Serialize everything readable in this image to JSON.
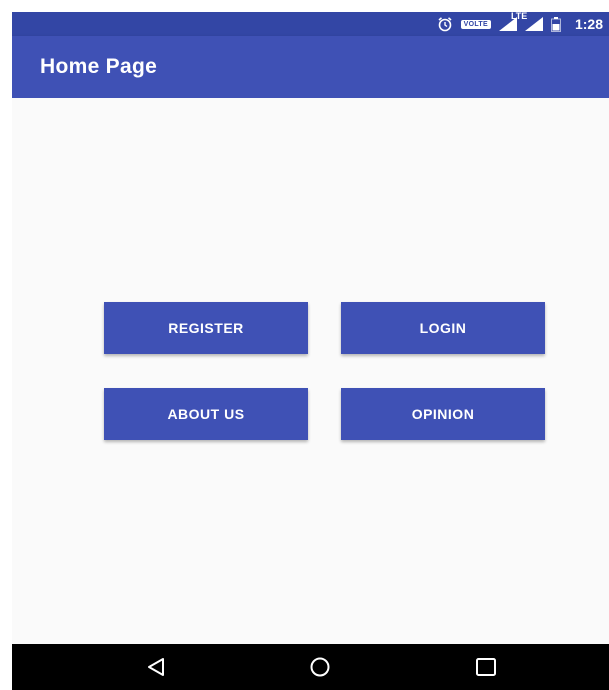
{
  "status_bar": {
    "volte_label": "VOLTE",
    "lte_label": "LTE",
    "time": "1:28",
    "icons": [
      "alarm-icon",
      "volte-icon",
      "signal-icon",
      "lte-signal-icon",
      "battery-icon"
    ]
  },
  "app_bar": {
    "title": "Home Page"
  },
  "buttons": {
    "register": "REGISTER",
    "login": "LOGIN",
    "about": "ABOUT US",
    "opinion": "OPINION"
  },
  "nav_bar": {
    "icons": [
      "back-icon",
      "home-icon",
      "recents-icon"
    ]
  },
  "colors": {
    "primary": "#3f51b5",
    "primary_dark": "#3346a5",
    "background": "#fafafa",
    "nav_bar": "#000000",
    "text_on_primary": "#ffffff"
  }
}
